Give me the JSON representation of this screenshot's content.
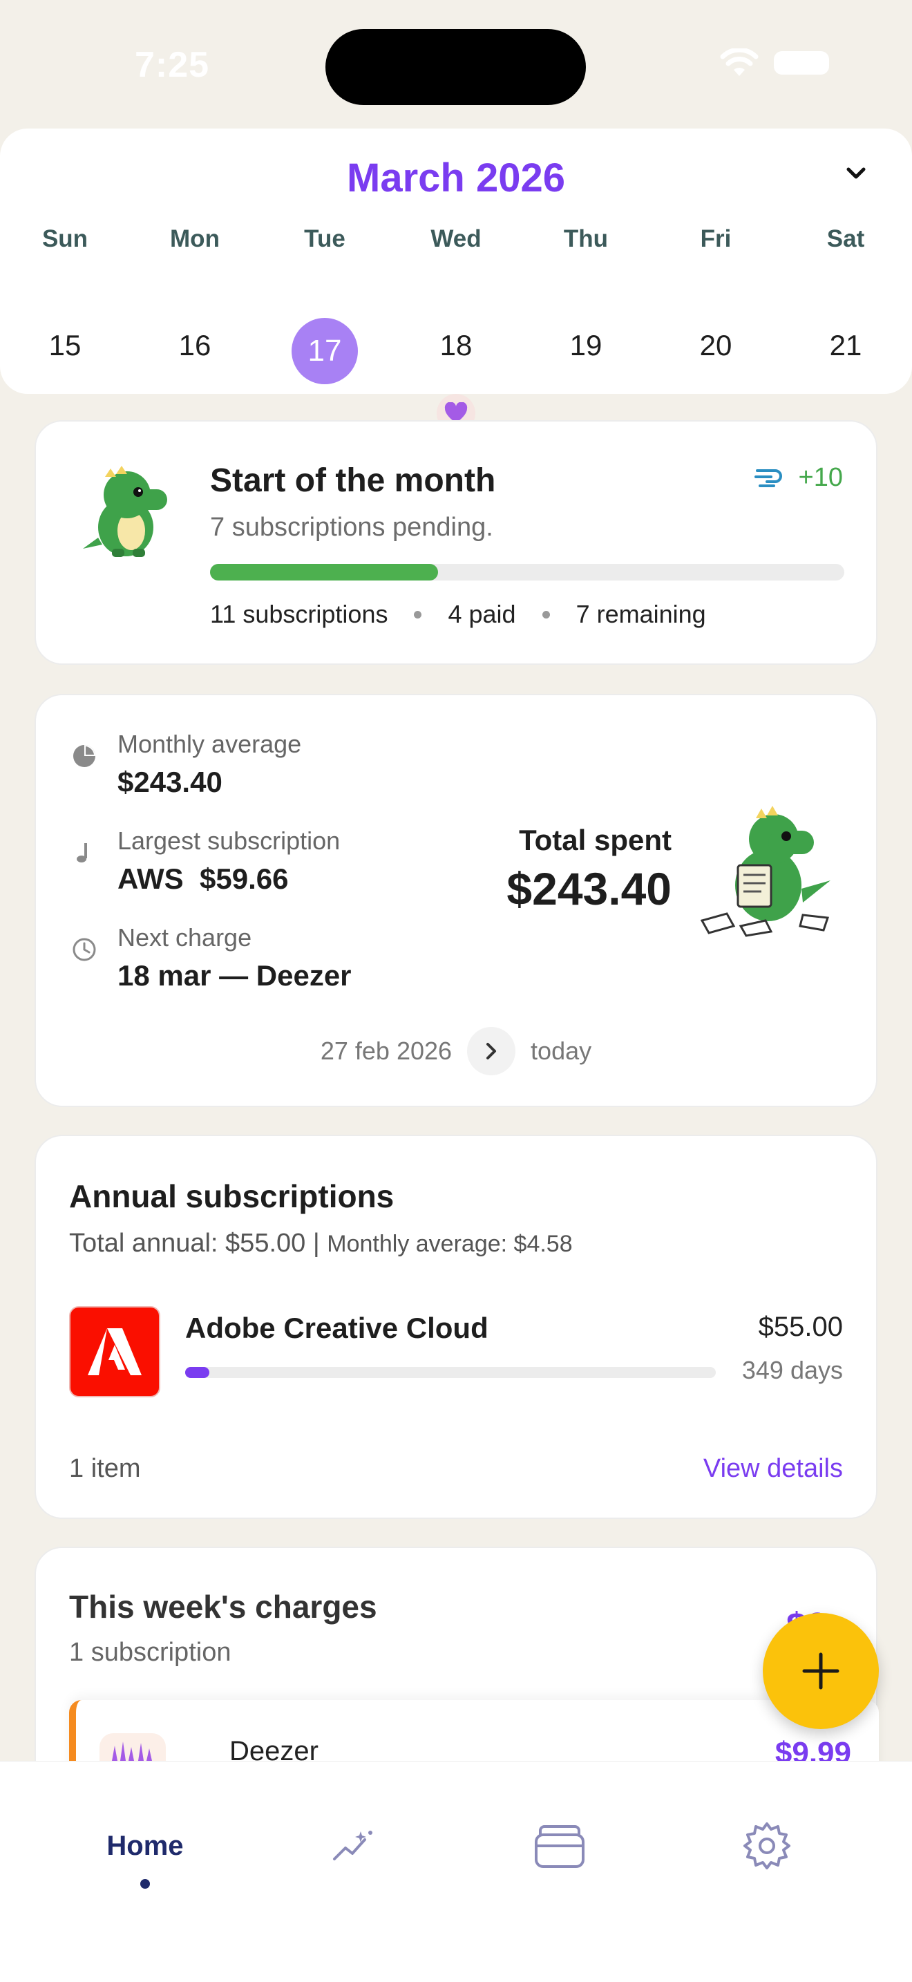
{
  "status_bar": {
    "time": "7:25"
  },
  "calendar": {
    "month": "March 2026",
    "weekdays": [
      "Sun",
      "Mon",
      "Tue",
      "Wed",
      "Thu",
      "Fri",
      "Sat"
    ],
    "days": [
      "15",
      "16",
      "17",
      "18",
      "19",
      "20",
      "21"
    ],
    "selected_day": "17"
  },
  "month_progress": {
    "title": "Start of the month",
    "subtitle": "7 subscriptions pending.",
    "points": "+10",
    "progress_fraction": 0.36,
    "total": "11 subscriptions",
    "paid": "4 paid",
    "remaining": "7 remaining"
  },
  "spending": {
    "monthly_average_label": "Monthly average",
    "monthly_average_value": "$243.40",
    "largest_label": "Largest subscription",
    "largest_value": "AWS  $59.66",
    "next_charge_label": "Next charge",
    "next_charge_value": "18 mar — Deezer",
    "total_label": "Total spent",
    "total_value": "$243.40",
    "range_start": "27 feb 2026",
    "range_end": "today"
  },
  "annual": {
    "title": "Annual subscriptions",
    "total_annual": "Total annual: $55.00",
    "separator": "|",
    "monthly_average": "Monthly average: $4.58",
    "item_name": "Adobe Creative Cloud",
    "item_price": "$55.00",
    "item_days": "349 days",
    "item_progress_fraction": 0.045,
    "count": "1 item",
    "view_details": "View details"
  },
  "week": {
    "title": "This week's charges",
    "subtitle": "1 subscription",
    "amount": "$9",
    "item_name": "Deezer",
    "item_price": "$9.99"
  },
  "tabbar": {
    "home": "Home"
  },
  "icons": {
    "month_chevron": "chevron-down-icon",
    "points": "speed-lines-icon",
    "monthly_average": "pie-chart-icon",
    "largest": "music-note-icon",
    "next_charge": "clock-icon",
    "range_next": "chevron-right-icon",
    "fab": "plus-icon",
    "stats_tab": "sparkle-chart-icon",
    "cards_tab": "wallet-icon",
    "settings_tab": "gear-icon"
  },
  "colors": {
    "accent": "#7a3cf0",
    "progress": "#4db04f",
    "fab": "#fbc20b",
    "nav": "#1f2a6b"
  }
}
